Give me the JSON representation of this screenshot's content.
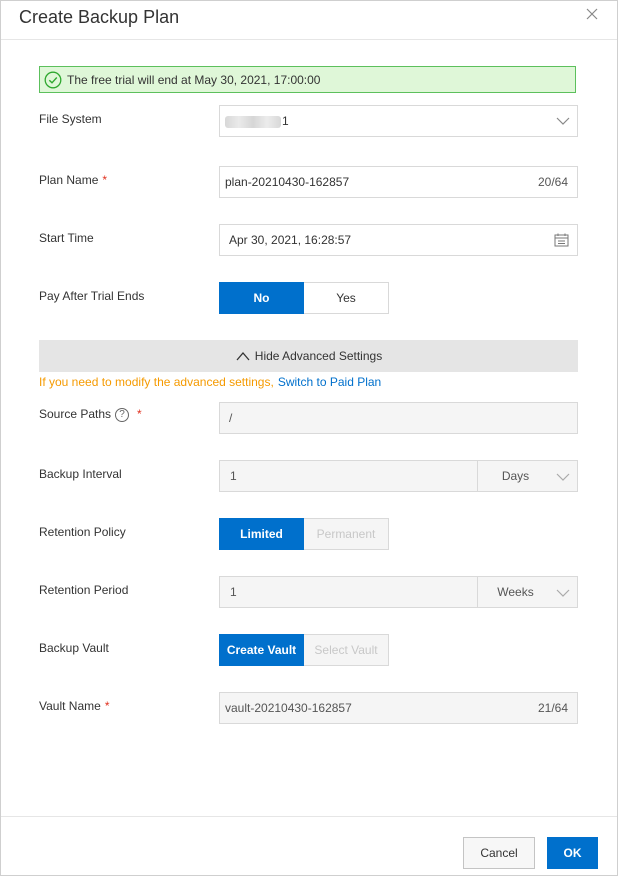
{
  "dialog": {
    "title": "Create Backup Plan",
    "close_icon": "close-icon"
  },
  "notice": {
    "icon": "check-circle-icon",
    "text": "The free trial will end at May 30, 2021, 17:00:00",
    "colors": {
      "background": "#dff7d8",
      "border": "#5cc05c"
    }
  },
  "fields": {
    "file_system": {
      "label": "File System",
      "value_suffix": "1",
      "icon": "chevron-down-icon"
    },
    "plan_name": {
      "label": "Plan Name",
      "required_mark": "*",
      "value": "plan-20210430-162857",
      "counter": "20/64"
    },
    "start_time": {
      "label": "Start Time",
      "value": "Apr 30, 2021, 16:28:57",
      "icon": "calendar-icon"
    },
    "pay_after_trial": {
      "label": "Pay After Trial Ends",
      "options": [
        "No",
        "Yes"
      ],
      "selected": "No"
    }
  },
  "advanced": {
    "toggle_label": "Hide Advanced Settings",
    "toggle_icon": "chevron-up-icon",
    "paid_hint": "If you need to modify the advanced settings,",
    "paid_link": "Switch to Paid Plan",
    "source_paths": {
      "label": "Source Paths",
      "help": "?",
      "required_mark": "*",
      "value": "/"
    },
    "backup_interval": {
      "label": "Backup Interval",
      "value": "1",
      "unit": "Days"
    },
    "retention_policy": {
      "label": "Retention Policy",
      "options": [
        "Limited",
        "Permanent"
      ],
      "selected": "Limited"
    },
    "retention_period": {
      "label": "Retention Period",
      "value": "1",
      "unit": "Weeks"
    },
    "backup_vault": {
      "label": "Backup Vault",
      "options": [
        "Create Vault",
        "Select Vault"
      ],
      "selected": "Create Vault"
    },
    "vault_name": {
      "label": "Vault Name",
      "required_mark": "*",
      "value": "vault-20210430-162857",
      "counter": "21/64"
    }
  },
  "footer": {
    "cancel_label": "Cancel",
    "ok_label": "OK"
  },
  "colors": {
    "accent": "#0070cc",
    "warning": "#f59a00",
    "required": "#e0301e"
  }
}
